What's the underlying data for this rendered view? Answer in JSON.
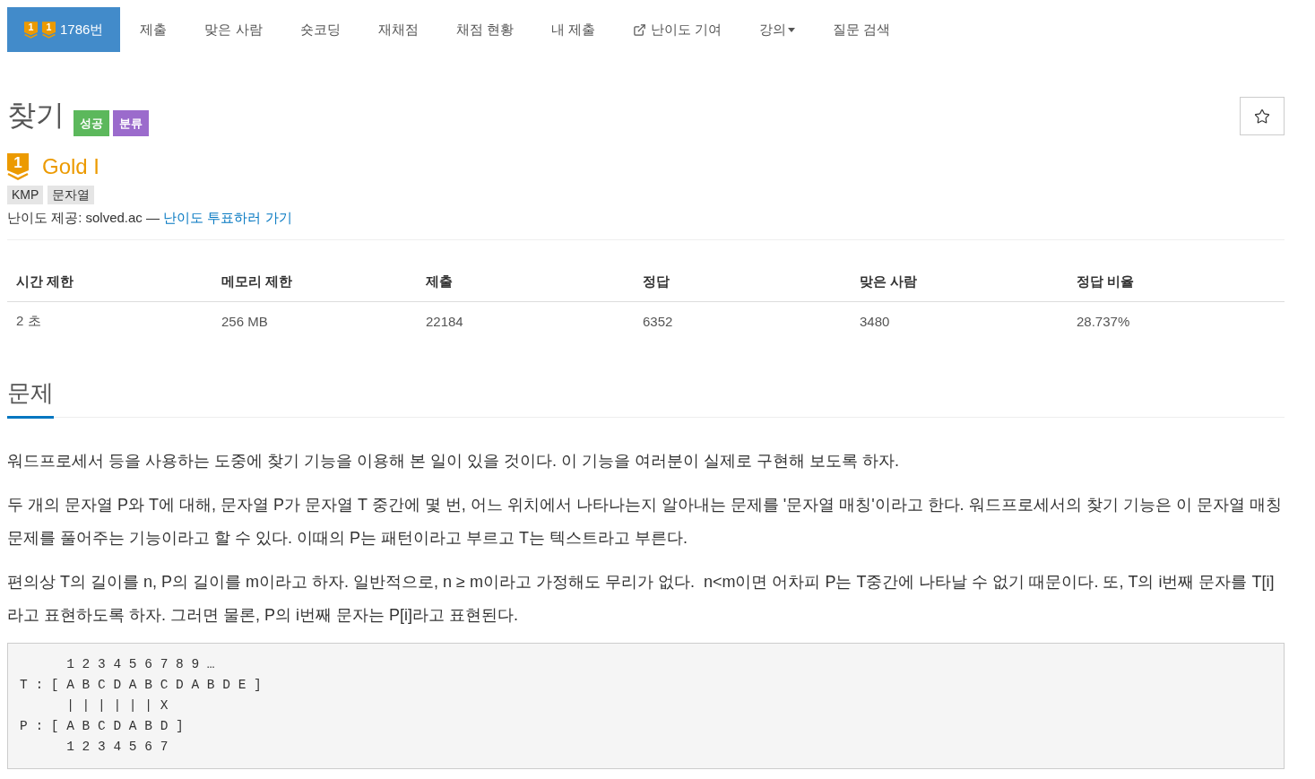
{
  "nav": {
    "tabs": [
      {
        "kind": "problem",
        "label": "1786번",
        "badges": [
          "1",
          "1"
        ],
        "selected": true
      },
      {
        "kind": "plain",
        "label": "제출",
        "selected": false
      },
      {
        "kind": "plain",
        "label": "맞은 사람",
        "selected": false
      },
      {
        "kind": "plain",
        "label": "숏코딩",
        "selected": false
      },
      {
        "kind": "plain",
        "label": "재채점",
        "selected": false
      },
      {
        "kind": "plain",
        "label": "채점 현황",
        "selected": false
      },
      {
        "kind": "plain",
        "label": "내 제출",
        "selected": false
      },
      {
        "kind": "external",
        "label": "난이도 기여",
        "selected": false
      },
      {
        "kind": "dropdown",
        "label": "강의",
        "selected": false
      },
      {
        "kind": "plain",
        "label": "질문 검색",
        "selected": false
      }
    ]
  },
  "problem": {
    "title": "찾기",
    "labels": [
      {
        "text": "성공",
        "color": "#5cb85c"
      },
      {
        "text": "분류",
        "color": "#9b6bcc"
      }
    ],
    "tier": {
      "badge": "1",
      "name": "Gold I"
    },
    "tags": [
      "KMP",
      "문자열"
    ],
    "difficulty": {
      "text": "난이도 제공: solved.ac —",
      "link": "난이도 투표하러 가기"
    }
  },
  "stats": {
    "columns": [
      "시간 제한",
      "메모리 제한",
      "제출",
      "정답",
      "맞은 사람",
      "정답 비율"
    ],
    "rows": [
      [
        "2 초",
        "256 MB",
        "22184",
        "6352",
        "3480",
        "28.737%"
      ]
    ]
  },
  "section": {
    "title": "문제",
    "paragraphs": [
      "워드프로세서 등을 사용하는 도중에 찾기 기능을 이용해 본 일이 있을 것이다. 이 기능을 여러분이 실제로 구현해 보도록 하자.",
      "두 개의 문자열 P와 T에 대해, 문자열 P가 문자열 T 중간에 몇 번, 어느 위치에서 나타나는지 알아내는 문제를 '문자열 매칭'이라고 한다. 워드프로세서의 찾기 기능은 이 문자열 매칭 문제를 풀어주는 기능이라고 할 수 있다. 이때의 P는 패턴이라고 부르고 T는 텍스트라고 부른다.",
      "편의상 T의 길이를 n, P의 길이를 m이라고 하자. 일반적으로, n ≥ m이라고 가정해도 무리가 없다.  n<m이면 어차피 P는 T중간에 나타날 수 없기 때문이다. 또, T의 i번째 문자를 T[i]라고 표현하도록 하자. 그러면 물론, P의 i번째 문자는 P[i]라고 표현된다."
    ],
    "code": [
      "      1 2 3 4 5 6 7 8 9 …",
      "T : [ A B C D A B C D A B D E ]",
      "      | | | | | | X",
      "P : [ A B C D A B D ]",
      "      1 2 3 4 5 6 7"
    ]
  }
}
